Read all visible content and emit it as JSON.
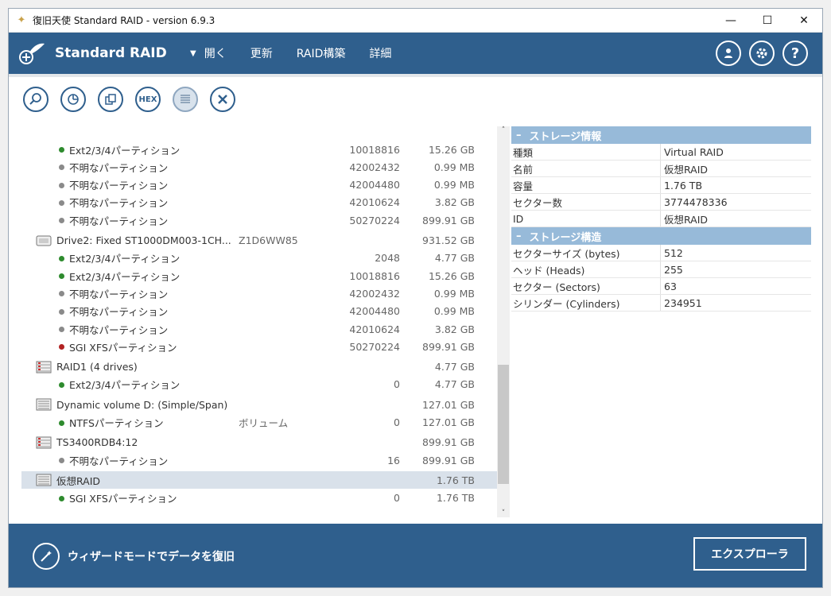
{
  "window": {
    "title": "復旧天使 Standard RAID - version 6.9.3"
  },
  "header": {
    "brand": "Standard RAID",
    "menu": [
      "開く",
      "更新",
      "RAID構築",
      "詳細"
    ]
  },
  "toolbar": {
    "hex_label": "HEX",
    "icons": [
      "search-icon",
      "pie-chart-icon",
      "copy-icon",
      "hex-icon",
      "list-icon",
      "close-icon"
    ]
  },
  "tree": [
    {
      "type": "part",
      "dot": "#2e8b2e",
      "label": "Ext2/3/4パーティション",
      "sector": "10018816",
      "size": "15.26 GB"
    },
    {
      "type": "part",
      "dot": "#8a8a8a",
      "label": "不明なパーティション",
      "sector": "42002432",
      "size": "0.99 MB"
    },
    {
      "type": "part",
      "dot": "#8a8a8a",
      "label": "不明なパーティション",
      "sector": "42004480",
      "size": "0.99 MB"
    },
    {
      "type": "part",
      "dot": "#8a8a8a",
      "label": "不明なパーティション",
      "sector": "42010624",
      "size": "3.82 GB"
    },
    {
      "type": "part",
      "dot": "#8a8a8a",
      "label": "不明なパーティション",
      "sector": "50270224",
      "size": "899.91 GB"
    },
    {
      "type": "drive",
      "icon": "hdd",
      "label": "Drive2: Fixed ST1000DM003-1CH...",
      "serial": "Z1D6WW85",
      "size": "931.52 GB"
    },
    {
      "type": "part",
      "dot": "#2e8b2e",
      "label": "Ext2/3/4パーティション",
      "sector": "2048",
      "size": "4.77 GB"
    },
    {
      "type": "part",
      "dot": "#2e8b2e",
      "label": "Ext2/3/4パーティション",
      "sector": "10018816",
      "size": "15.26 GB"
    },
    {
      "type": "part",
      "dot": "#8a8a8a",
      "label": "不明なパーティション",
      "sector": "42002432",
      "size": "0.99 MB"
    },
    {
      "type": "part",
      "dot": "#8a8a8a",
      "label": "不明なパーティション",
      "sector": "42004480",
      "size": "0.99 MB"
    },
    {
      "type": "part",
      "dot": "#8a8a8a",
      "label": "不明なパーティション",
      "sector": "42010624",
      "size": "3.82 GB"
    },
    {
      "type": "part",
      "dot": "#b22222",
      "label": "SGI XFSパーティション",
      "sector": "50270224",
      "size": "899.91 GB"
    },
    {
      "type": "drive",
      "icon": "raid",
      "label": "RAID1 (4 drives)",
      "serial": "",
      "size": "4.77 GB"
    },
    {
      "type": "part",
      "dot": "#2e8b2e",
      "label": "Ext2/3/4パーティション",
      "sector": "0",
      "size": "4.77 GB"
    },
    {
      "type": "drive",
      "icon": "dynamic",
      "label": "Dynamic volume D: (Simple/Span)",
      "serial": "",
      "size": "127.01 GB"
    },
    {
      "type": "part",
      "dot": "#2e8b2e",
      "label": "NTFSパーティション",
      "extra": "ボリューム",
      "sector": "0",
      "size": "127.01 GB"
    },
    {
      "type": "drive",
      "icon": "raid",
      "label": "TS3400RDB4:12",
      "serial": "",
      "size": "899.91 GB"
    },
    {
      "type": "part",
      "dot": "#8a8a8a",
      "label": "不明なパーティション",
      "sector": "16",
      "size": "899.91 GB"
    },
    {
      "type": "drive",
      "icon": "dynamic",
      "label": "仮想RAID",
      "serial": "",
      "size": "1.76 TB",
      "selected": true
    },
    {
      "type": "part",
      "dot": "#2e8b2e",
      "label": "SGI XFSパーティション",
      "sector": "0",
      "size": "1.76 TB"
    }
  ],
  "info": {
    "storage_info": {
      "heading": "ストレージ情報",
      "rows": [
        {
          "k": "種類",
          "v": "Virtual RAID"
        },
        {
          "k": "名前",
          "v": "仮想RAID"
        },
        {
          "k": "容量",
          "v": "1.76 TB"
        },
        {
          "k": "セクター数",
          "v": "3774478336"
        },
        {
          "k": "ID",
          "v": "仮想RAID"
        }
      ]
    },
    "storage_struct": {
      "heading": "ストレージ構造",
      "rows": [
        {
          "k": "セクターサイズ (bytes)",
          "v": "512"
        },
        {
          "k": "ヘッド (Heads)",
          "v": "255"
        },
        {
          "k": "セクター (Sectors)",
          "v": "63"
        },
        {
          "k": "シリンダー (Cylinders)",
          "v": "234951"
        }
      ]
    }
  },
  "footer": {
    "wizard_label": "ウィザードモードでデータを復旧",
    "explorer_label": "エクスプローラ"
  }
}
